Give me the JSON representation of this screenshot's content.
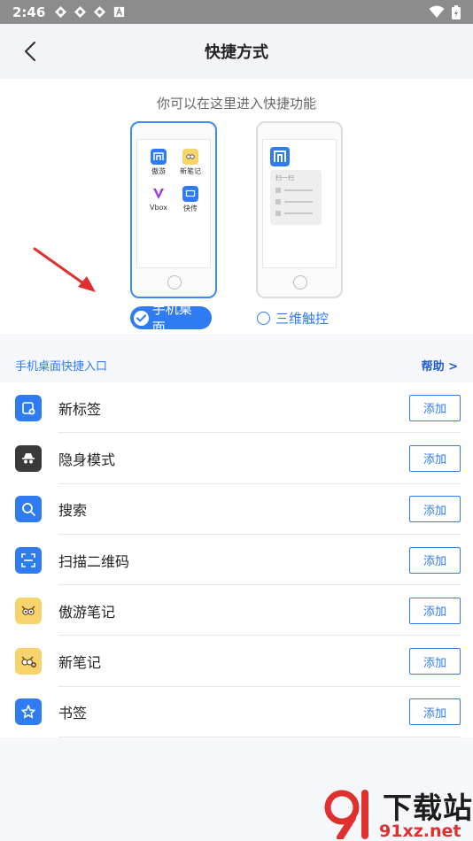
{
  "status_bar": {
    "time": "2:46"
  },
  "header": {
    "title": "快捷方式"
  },
  "mode_selector": {
    "hint": "你可以在这里进入快捷功能",
    "desktop_option": "手机桌面",
    "touch_option": "三维触控",
    "desktop_preview_apps": [
      "傲游",
      "新笔记",
      "Vbox",
      "快传"
    ],
    "touch_preview_menu_label": "扫一扫",
    "selected": "手机桌面"
  },
  "section": {
    "title": "手机桌面快捷入口",
    "help": "帮助 >"
  },
  "shortcuts": [
    {
      "label": "新标签",
      "button": "添加",
      "icon": "new-tab-icon",
      "color": "#2f7bf2"
    },
    {
      "label": "隐身模式",
      "button": "添加",
      "icon": "incognito-icon",
      "color": "#3a3a3a"
    },
    {
      "label": "搜索",
      "button": "添加",
      "icon": "search-icon",
      "color": "#2f7bf2"
    },
    {
      "label": "扫描二维码",
      "button": "添加",
      "icon": "qr-scan-icon",
      "color": "#2f7bf2"
    },
    {
      "label": "傲游笔记",
      "button": "添加",
      "icon": "note-owl-icon",
      "color": "#f6d36b"
    },
    {
      "label": "新笔记",
      "button": "添加",
      "icon": "new-note-icon",
      "color": "#f6d36b"
    },
    {
      "label": "书签",
      "button": "添加",
      "icon": "bookmark-star-icon",
      "color": "#2f7bf2"
    }
  ],
  "watermark": {
    "top": "下载站",
    "bottom": "91xz.net"
  },
  "colors": {
    "accent": "#2f7bf2",
    "annotation": "#e0302d",
    "status_bar": "#8c8c8c"
  }
}
